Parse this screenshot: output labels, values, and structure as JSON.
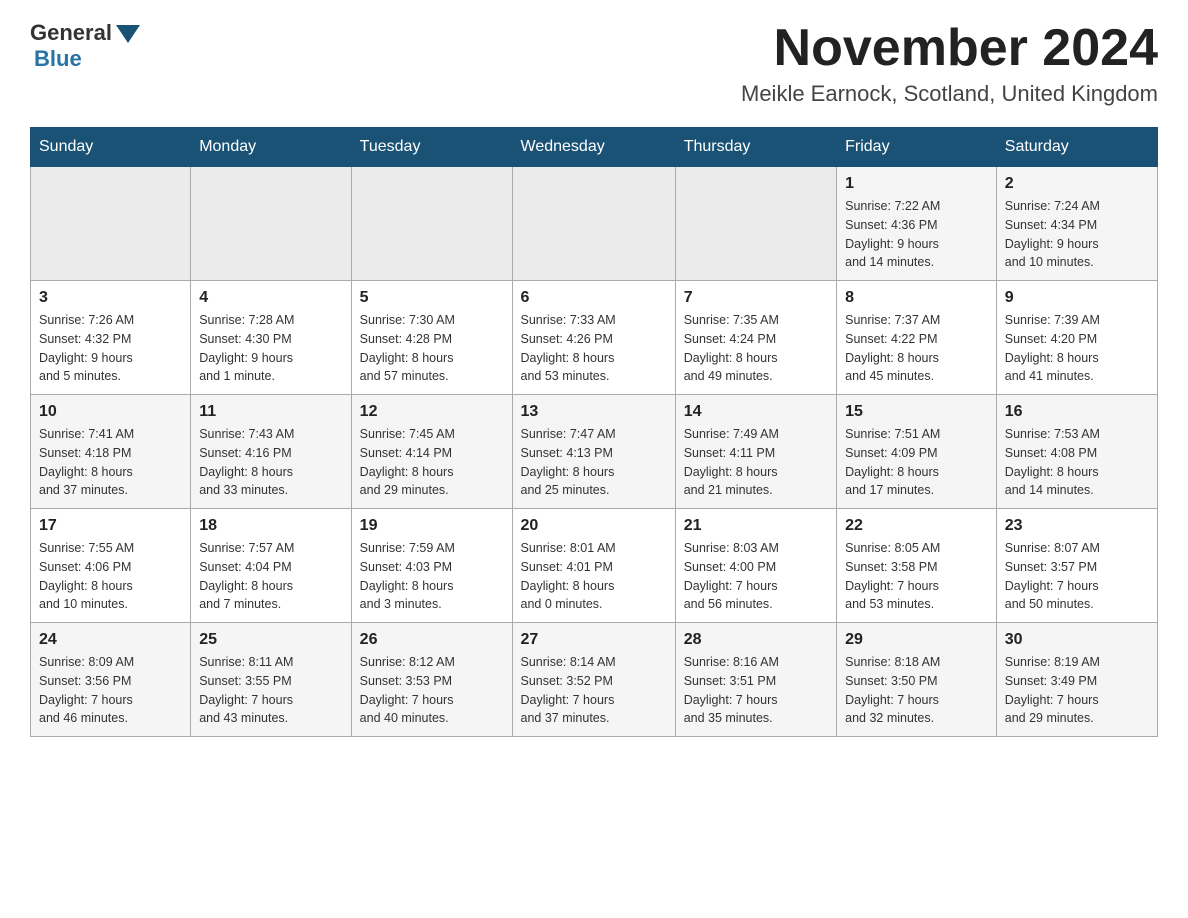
{
  "header": {
    "logo": {
      "general": "General",
      "blue": "Blue"
    },
    "month_year": "November 2024",
    "location": "Meikle Earnock, Scotland, United Kingdom"
  },
  "weekdays": [
    "Sunday",
    "Monday",
    "Tuesday",
    "Wednesday",
    "Thursday",
    "Friday",
    "Saturday"
  ],
  "weeks": [
    {
      "id": "week0",
      "days": [
        {
          "date": "",
          "info": ""
        },
        {
          "date": "",
          "info": ""
        },
        {
          "date": "",
          "info": ""
        },
        {
          "date": "",
          "info": ""
        },
        {
          "date": "",
          "info": ""
        },
        {
          "date": "1",
          "info": "Sunrise: 7:22 AM\nSunset: 4:36 PM\nDaylight: 9 hours\nand 14 minutes."
        },
        {
          "date": "2",
          "info": "Sunrise: 7:24 AM\nSunset: 4:34 PM\nDaylight: 9 hours\nand 10 minutes."
        }
      ]
    },
    {
      "id": "week1",
      "days": [
        {
          "date": "3",
          "info": "Sunrise: 7:26 AM\nSunset: 4:32 PM\nDaylight: 9 hours\nand 5 minutes."
        },
        {
          "date": "4",
          "info": "Sunrise: 7:28 AM\nSunset: 4:30 PM\nDaylight: 9 hours\nand 1 minute."
        },
        {
          "date": "5",
          "info": "Sunrise: 7:30 AM\nSunset: 4:28 PM\nDaylight: 8 hours\nand 57 minutes."
        },
        {
          "date": "6",
          "info": "Sunrise: 7:33 AM\nSunset: 4:26 PM\nDaylight: 8 hours\nand 53 minutes."
        },
        {
          "date": "7",
          "info": "Sunrise: 7:35 AM\nSunset: 4:24 PM\nDaylight: 8 hours\nand 49 minutes."
        },
        {
          "date": "8",
          "info": "Sunrise: 7:37 AM\nSunset: 4:22 PM\nDaylight: 8 hours\nand 45 minutes."
        },
        {
          "date": "9",
          "info": "Sunrise: 7:39 AM\nSunset: 4:20 PM\nDaylight: 8 hours\nand 41 minutes."
        }
      ]
    },
    {
      "id": "week2",
      "days": [
        {
          "date": "10",
          "info": "Sunrise: 7:41 AM\nSunset: 4:18 PM\nDaylight: 8 hours\nand 37 minutes."
        },
        {
          "date": "11",
          "info": "Sunrise: 7:43 AM\nSunset: 4:16 PM\nDaylight: 8 hours\nand 33 minutes."
        },
        {
          "date": "12",
          "info": "Sunrise: 7:45 AM\nSunset: 4:14 PM\nDaylight: 8 hours\nand 29 minutes."
        },
        {
          "date": "13",
          "info": "Sunrise: 7:47 AM\nSunset: 4:13 PM\nDaylight: 8 hours\nand 25 minutes."
        },
        {
          "date": "14",
          "info": "Sunrise: 7:49 AM\nSunset: 4:11 PM\nDaylight: 8 hours\nand 21 minutes."
        },
        {
          "date": "15",
          "info": "Sunrise: 7:51 AM\nSunset: 4:09 PM\nDaylight: 8 hours\nand 17 minutes."
        },
        {
          "date": "16",
          "info": "Sunrise: 7:53 AM\nSunset: 4:08 PM\nDaylight: 8 hours\nand 14 minutes."
        }
      ]
    },
    {
      "id": "week3",
      "days": [
        {
          "date": "17",
          "info": "Sunrise: 7:55 AM\nSunset: 4:06 PM\nDaylight: 8 hours\nand 10 minutes."
        },
        {
          "date": "18",
          "info": "Sunrise: 7:57 AM\nSunset: 4:04 PM\nDaylight: 8 hours\nand 7 minutes."
        },
        {
          "date": "19",
          "info": "Sunrise: 7:59 AM\nSunset: 4:03 PM\nDaylight: 8 hours\nand 3 minutes."
        },
        {
          "date": "20",
          "info": "Sunrise: 8:01 AM\nSunset: 4:01 PM\nDaylight: 8 hours\nand 0 minutes."
        },
        {
          "date": "21",
          "info": "Sunrise: 8:03 AM\nSunset: 4:00 PM\nDaylight: 7 hours\nand 56 minutes."
        },
        {
          "date": "22",
          "info": "Sunrise: 8:05 AM\nSunset: 3:58 PM\nDaylight: 7 hours\nand 53 minutes."
        },
        {
          "date": "23",
          "info": "Sunrise: 8:07 AM\nSunset: 3:57 PM\nDaylight: 7 hours\nand 50 minutes."
        }
      ]
    },
    {
      "id": "week4",
      "days": [
        {
          "date": "24",
          "info": "Sunrise: 8:09 AM\nSunset: 3:56 PM\nDaylight: 7 hours\nand 46 minutes."
        },
        {
          "date": "25",
          "info": "Sunrise: 8:11 AM\nSunset: 3:55 PM\nDaylight: 7 hours\nand 43 minutes."
        },
        {
          "date": "26",
          "info": "Sunrise: 8:12 AM\nSunset: 3:53 PM\nDaylight: 7 hours\nand 40 minutes."
        },
        {
          "date": "27",
          "info": "Sunrise: 8:14 AM\nSunset: 3:52 PM\nDaylight: 7 hours\nand 37 minutes."
        },
        {
          "date": "28",
          "info": "Sunrise: 8:16 AM\nSunset: 3:51 PM\nDaylight: 7 hours\nand 35 minutes."
        },
        {
          "date": "29",
          "info": "Sunrise: 8:18 AM\nSunset: 3:50 PM\nDaylight: 7 hours\nand 32 minutes."
        },
        {
          "date": "30",
          "info": "Sunrise: 8:19 AM\nSunset: 3:49 PM\nDaylight: 7 hours\nand 29 minutes."
        }
      ]
    }
  ]
}
